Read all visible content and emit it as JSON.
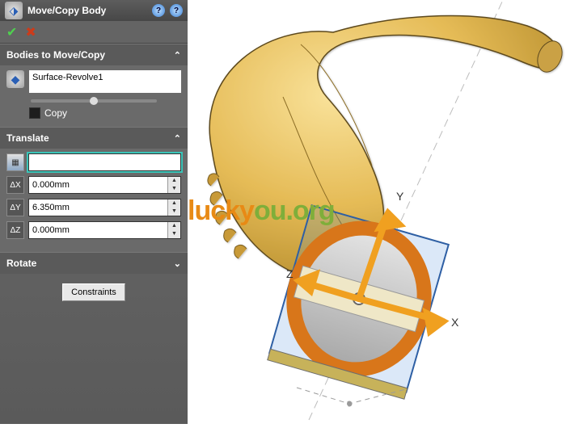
{
  "panel": {
    "title": "Move/Copy Body",
    "help1": "?",
    "help2": "?",
    "ok_glyph": "✔",
    "cancel_glyph": "✖",
    "bodies_header": "Bodies to Move/Copy",
    "bodies_list_value": "Surface-Revolve1",
    "copy_label": "Copy",
    "translate_header": "Translate",
    "translate_chev": "⌃",
    "bodies_chev": "⌃",
    "rotate_chev": "⌄",
    "dx_label": "ΔX",
    "dy_label": "ΔY",
    "dz_label": "ΔZ",
    "dx_value": "0.000mm",
    "dy_value": "6.350mm",
    "dz_value": "0.000mm",
    "rotate_header": "Rotate",
    "constraints_label": "Constraints"
  },
  "viewport": {
    "axis_x_label": "X",
    "axis_y_label": "Y",
    "axis_z_label": "Z",
    "widget_center_mark": "◦"
  },
  "watermark": {
    "seg1": "lucky",
    "seg2": "ou.org"
  },
  "colors": {
    "body_fill": "#e5bb56",
    "body_shade": "#b88f2f",
    "body_highlight": "#f9e29a",
    "triad_color": "#f0a020",
    "selection_blue": "#3a82d8",
    "ring_fill": "#d8761a"
  }
}
